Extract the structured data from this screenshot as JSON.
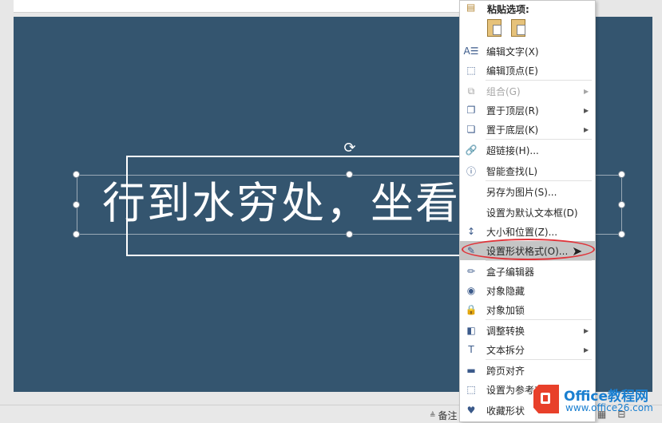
{
  "slide": {
    "text": "行到水穷处，坐看",
    "background": "#34556f"
  },
  "context_menu": {
    "header": "粘贴选项:",
    "paste_options": [
      "keep-source-formatting",
      "picture"
    ],
    "items": [
      {
        "label": "编辑文字(X)",
        "icon": "edit-text-icon",
        "enabled": true,
        "submenu": false
      },
      {
        "label": "编辑顶点(E)",
        "icon": "edit-points-icon",
        "enabled": true,
        "submenu": false
      },
      {
        "label": "组合(G)",
        "icon": "group-icon",
        "enabled": false,
        "submenu": true
      },
      {
        "label": "置于顶层(R)",
        "icon": "bring-front-icon",
        "enabled": true,
        "submenu": true
      },
      {
        "label": "置于底层(K)",
        "icon": "send-back-icon",
        "enabled": true,
        "submenu": true
      },
      {
        "label": "超链接(H)...",
        "icon": "hyperlink-icon",
        "enabled": true,
        "submenu": false
      },
      {
        "label": "智能查找(L)",
        "icon": "smart-lookup-icon",
        "enabled": true,
        "submenu": false
      },
      {
        "label": "另存为图片(S)...",
        "icon": "",
        "enabled": true,
        "submenu": false
      },
      {
        "label": "设置为默认文本框(D)",
        "icon": "",
        "enabled": true,
        "submenu": false
      },
      {
        "label": "大小和位置(Z)...",
        "icon": "size-position-icon",
        "enabled": true,
        "submenu": false
      },
      {
        "label": "设置形状格式(O)...",
        "icon": "format-shape-icon",
        "enabled": true,
        "submenu": false,
        "highlighted": true
      },
      {
        "label": "盒子编辑器",
        "icon": "box-editor-icon",
        "enabled": true,
        "submenu": false
      },
      {
        "label": "对象隐藏",
        "icon": "hide-eye-icon",
        "enabled": true,
        "submenu": false
      },
      {
        "label": "对象加锁",
        "icon": "lock-icon",
        "enabled": true,
        "submenu": false
      },
      {
        "label": "调整转换",
        "icon": "adjust-convert-icon",
        "enabled": true,
        "submenu": true
      },
      {
        "label": "文本拆分",
        "icon": "text-split-icon",
        "enabled": true,
        "submenu": true
      },
      {
        "label": "跨页对齐",
        "icon": "cross-page-align-icon",
        "enabled": true,
        "submenu": false
      },
      {
        "label": "设置为参考对",
        "icon": "set-reference-icon",
        "enabled": true,
        "submenu": false
      },
      {
        "label": "收藏形状",
        "icon": "favorite-shape-icon",
        "enabled": true,
        "submenu": false
      }
    ]
  },
  "status_bar": {
    "notes_label": "备注"
  },
  "watermark": {
    "title": "Office教程网",
    "url": "www.office26.com"
  }
}
